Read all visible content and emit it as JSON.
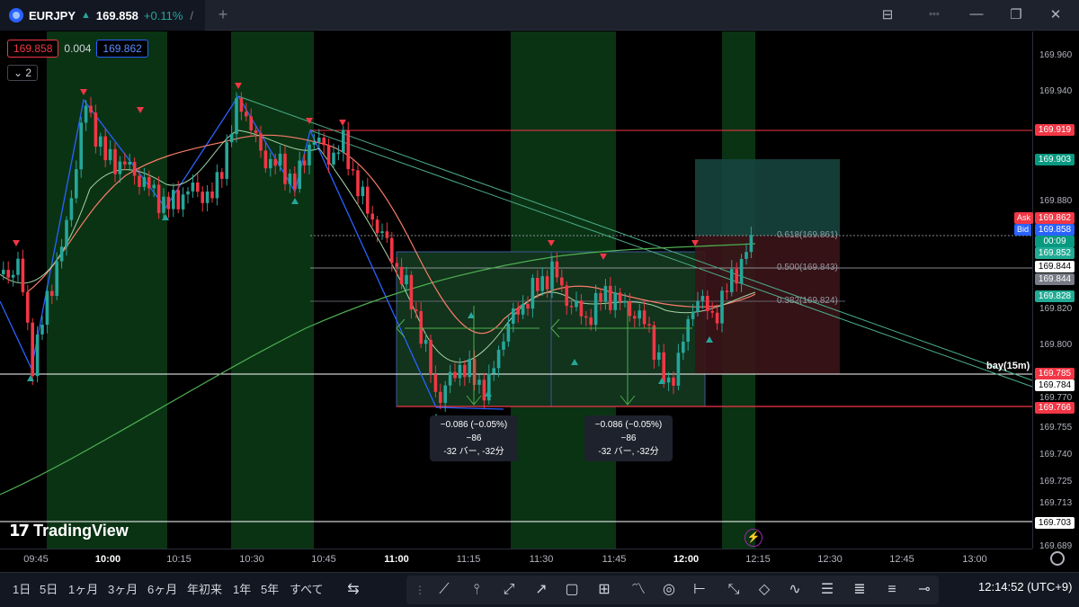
{
  "tab": {
    "symbol": "EURJPY",
    "direction_arrow": "▲",
    "price": "169.858",
    "change": "+0.11%",
    "close_glyph": "/",
    "new_tab": "+"
  },
  "window": {
    "layout_icon": "⊟",
    "more_icon": "◦◦◦",
    "minimize": "—",
    "restore": "❐",
    "close": "✕"
  },
  "quote": {
    "bid": "169.858",
    "spread": "0.004",
    "ask": "169.862",
    "collapse": "⌄ 2"
  },
  "price_scale": {
    "ticks": [
      "169.960",
      "169.940",
      "169.880",
      "169.820",
      "169.800",
      "169.770",
      "169.755",
      "169.740",
      "169.725",
      "169.713",
      "169.689"
    ],
    "labels": {
      "l919": "169.919",
      "l903": "169.903",
      "ask": "169.862",
      "bid": "169.858",
      "countdown": "00:09",
      "l852": "169.852",
      "l844a": "169.844",
      "l844b": "169.844",
      "l828": "169.828",
      "l785": "169.785",
      "l784": "169.784",
      "l766": "169.766",
      "l703": "169.703"
    },
    "ask_tag": "Ask",
    "bid_tag": "Bid"
  },
  "fib": {
    "f618": "0.618(169.861)",
    "f500": "0.500(169.843)",
    "f382": "0.382(169.824)"
  },
  "measure": [
    {
      "line1": "−0.086 (−0.05%) −86",
      "line2": "-32 バー, -32分"
    },
    {
      "line1": "−0.086 (−0.05%) −86",
      "line2": "-32 バー, -32分"
    }
  ],
  "bay_label": "bay(15m)",
  "watermark": "TradingView",
  "time_axis": [
    "09:45",
    "10:00",
    "10:15",
    "10:30",
    "10:45",
    "11:00",
    "11:15",
    "11:30",
    "11:45",
    "12:00",
    "12:15",
    "12:30",
    "12:45",
    "13:00"
  ],
  "ranges": [
    "1日",
    "5日",
    "1ヶ月",
    "3ヶ月",
    "6ヶ月",
    "年初来",
    "1年",
    "5年",
    "すべて"
  ],
  "clock": "12:14:52 (UTC+9)",
  "colors": {
    "up": "#26a69a",
    "down": "#f23645",
    "ask": "#f23645",
    "bid": "#2962ff",
    "session": "#0c3d18"
  }
}
